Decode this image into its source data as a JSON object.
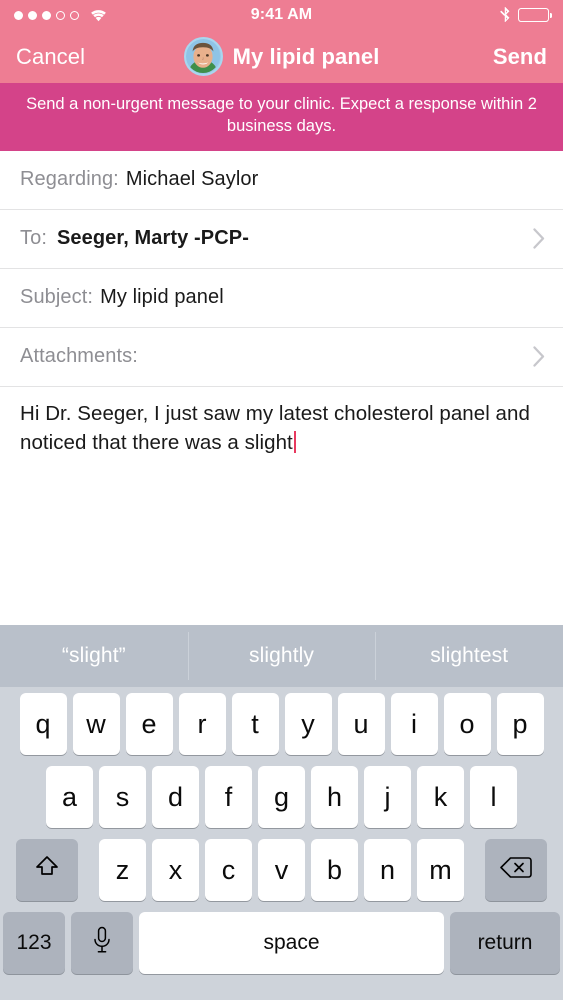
{
  "status_bar": {
    "signal_dots_filled": 3,
    "signal_dots_total": 5,
    "wifi_icon": "wifi-icon",
    "time": "9:41 AM",
    "bluetooth_icon": "bluetooth-icon",
    "battery_icon": "battery-full-icon",
    "battery_level": 100
  },
  "nav": {
    "cancel_label": "Cancel",
    "title": "My lipid panel",
    "send_label": "Send",
    "avatar_icon": "user-avatar-photo",
    "bar_color": "#ee7d93"
  },
  "banner": {
    "text": "Send a non-urgent message to your clinic. Expect a response within 2 business days.",
    "color": "#d44389"
  },
  "form": {
    "rows": [
      {
        "label": "Regarding:",
        "value": "Michael Saylor",
        "bold": false,
        "chevron": false
      },
      {
        "label": "To:",
        "value": "Seeger, Marty -PCP-",
        "bold": true,
        "chevron": true
      },
      {
        "label": "Subject:",
        "value": "My lipid panel",
        "bold": false,
        "chevron": false
      },
      {
        "label": "Attachments:",
        "value": "",
        "bold": false,
        "chevron": true
      }
    ]
  },
  "message": {
    "body": "Hi Dr. Seeger, I just saw my latest cholesterol panel and noticed that there was a slight",
    "caret_color": "#e8395e"
  },
  "keyboard": {
    "suggestions": [
      "“slight”",
      "slightly",
      "slightest"
    ],
    "row1": [
      "q",
      "w",
      "e",
      "r",
      "t",
      "y",
      "u",
      "i",
      "o",
      "p"
    ],
    "row2": [
      "a",
      "s",
      "d",
      "f",
      "g",
      "h",
      "j",
      "k",
      "l"
    ],
    "row3": [
      "z",
      "x",
      "c",
      "v",
      "b",
      "n",
      "m"
    ],
    "shift_icon": "shift-arrow-icon",
    "delete_icon": "backspace-icon",
    "numbers_label": "123",
    "mic_icon": "microphone-icon",
    "space_label": "space",
    "return_label": "return",
    "background_color": "#ced3da",
    "suggest_bar_color": "#b9c0ca"
  }
}
